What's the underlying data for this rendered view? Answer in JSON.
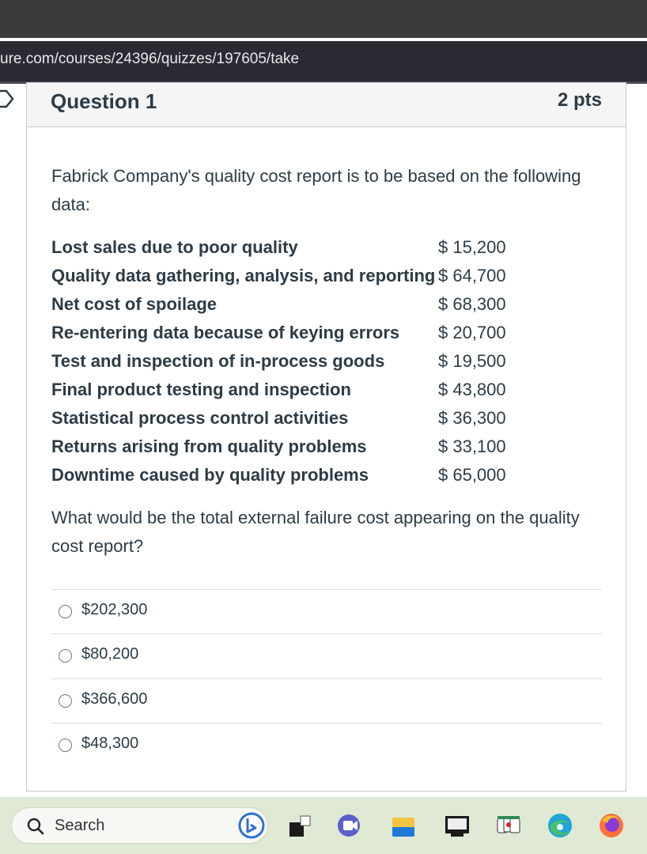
{
  "browser": {
    "url": "ure.com/courses/24396/quizzes/197605/take"
  },
  "question": {
    "title": "Question 1",
    "points": "2 pts",
    "intro": "Fabrick Company's quality cost report is to be based on the following data:",
    "rows": [
      {
        "label": "Lost sales due to poor quality",
        "value": "$ 15,200"
      },
      {
        "label": "Quality data gathering, analysis, and reporting",
        "value": "$ 64,700"
      },
      {
        "label": "Net cost of spoilage",
        "value": "$ 68,300"
      },
      {
        "label": "Re-entering data because of keying errors",
        "value": "$ 20,700"
      },
      {
        "label": "Test and inspection of in-process goods",
        "value": "$ 19,500"
      },
      {
        "label": "Final product testing and inspection",
        "value": "$ 43,800"
      },
      {
        "label": "Statistical process control activities",
        "value": "$ 36,300"
      },
      {
        "label": "Returns arising from quality problems",
        "value": "$ 33,100"
      },
      {
        "label": "Downtime caused by quality problems",
        "value": "$ 65,000"
      }
    ],
    "prompt": "What would be the total external failure cost appearing on the quality cost report?",
    "answers": [
      {
        "label": "$202,300"
      },
      {
        "label": "$80,200"
      },
      {
        "label": "$366,600"
      },
      {
        "label": "$48,300"
      }
    ]
  },
  "taskbar": {
    "search_label": "Search",
    "icons": [
      "bing-icon",
      "app-window-icon",
      "video-call-icon",
      "file-explorer-icon",
      "terminal-icon",
      "solitaire-icon",
      "edge-icon",
      "firefox-icon"
    ]
  }
}
